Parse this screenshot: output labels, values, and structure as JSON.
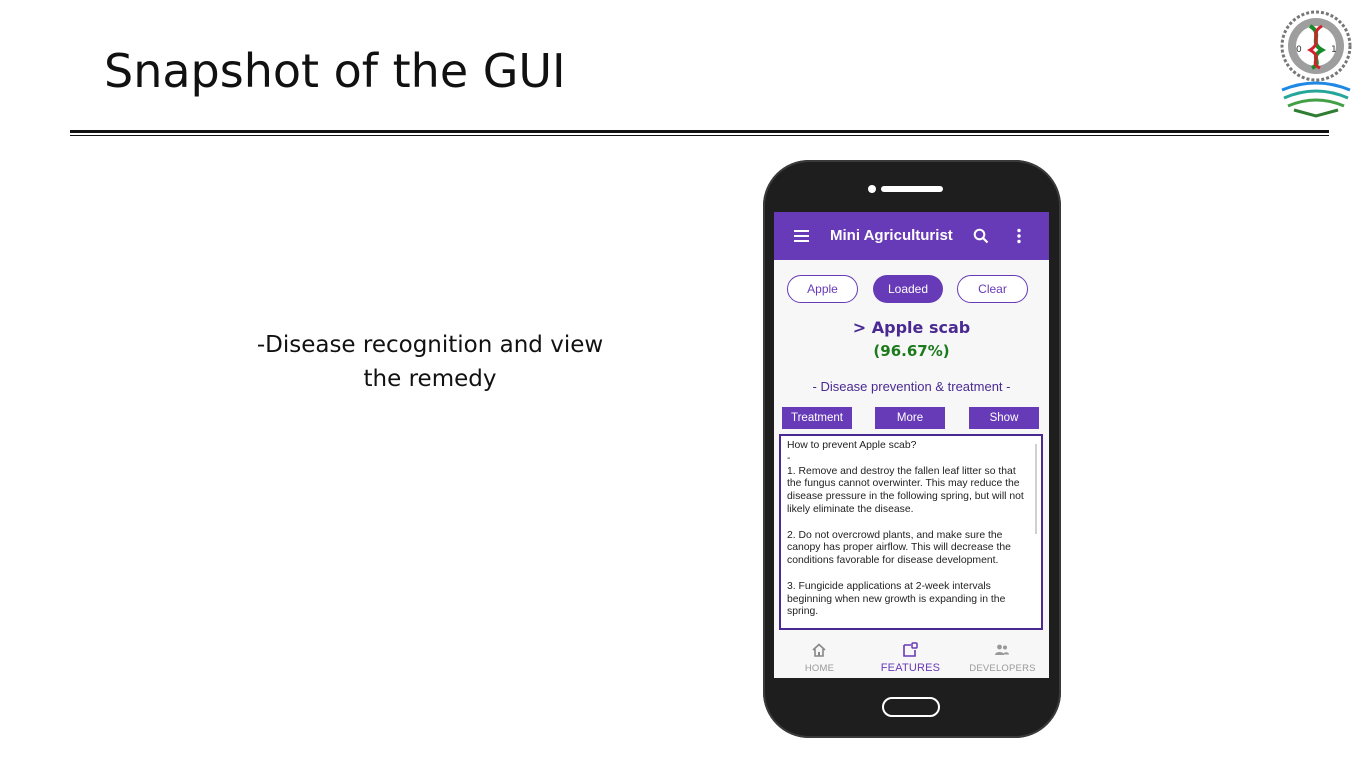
{
  "slide": {
    "title": "Snapshot of the GUI",
    "caption_line1": "-Disease recognition and view",
    "caption_line2": "the remedy",
    "logo_icon": "university-seal-icon"
  },
  "app": {
    "title": "Mini Agriculturist",
    "accent_color": "#673ab7",
    "icons": {
      "menu": "menu-icon",
      "search": "search-icon",
      "more": "more-vert-icon"
    },
    "controls": {
      "crop_button": "Apple",
      "loaded_button": "Loaded",
      "clear_button": "Clear"
    },
    "result": {
      "disease": "> Apple scab",
      "confidence": "(96.67%)",
      "confidence_color": "#1b7a1b"
    },
    "section_heading": "- Disease prevention & treatment -",
    "tabs": {
      "treatment": "Treatment",
      "more": "More",
      "show": "Show"
    },
    "remedy": {
      "question": "How to prevent Apple scab?",
      "dash": "-",
      "point1": "1. Remove and destroy the fallen leaf litter so that the fungus cannot overwinter. This may reduce the disease pressure in the following spring, but will not likely eliminate the disease.",
      "point2": "2. Do not overcrowd plants, and make sure the canopy has proper airflow. This will decrease the conditions favorable for disease development.",
      "point3": "3. Fungicide applications at 2-week intervals beginning when new growth is expanding in the spring."
    },
    "bottom_nav": {
      "home": "HOME",
      "features": "FEATURES",
      "developers": "DEVELOPERS",
      "active": "FEATURES"
    }
  }
}
